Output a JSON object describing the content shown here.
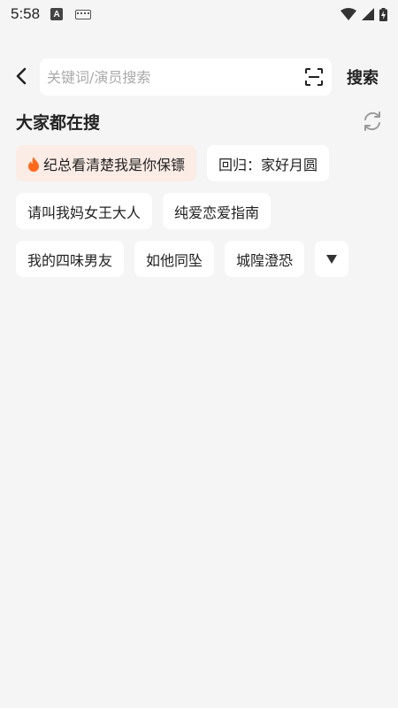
{
  "status_bar": {
    "time": "5:58",
    "app_icon_letter": "A"
  },
  "header": {
    "search_placeholder": "关键词/演员搜索",
    "search_button": "搜索"
  },
  "section": {
    "title": "大家都在搜"
  },
  "tags": [
    {
      "label": "纪总看清楚我是你保镖",
      "hot": true
    },
    {
      "label": "回归：家好月圆",
      "hot": false
    },
    {
      "label": "请叫我妈女王大人",
      "hot": false
    },
    {
      "label": "纯爱恋爱指南",
      "hot": false
    },
    {
      "label": "我的四味男友",
      "hot": false
    },
    {
      "label": "如他同坠",
      "hot": false
    },
    {
      "label": "城隍澄恐",
      "hot": false
    }
  ],
  "colors": {
    "hot_bg": "#fcece6",
    "fire": "#ff6a1a",
    "background": "#f5f5f5"
  }
}
